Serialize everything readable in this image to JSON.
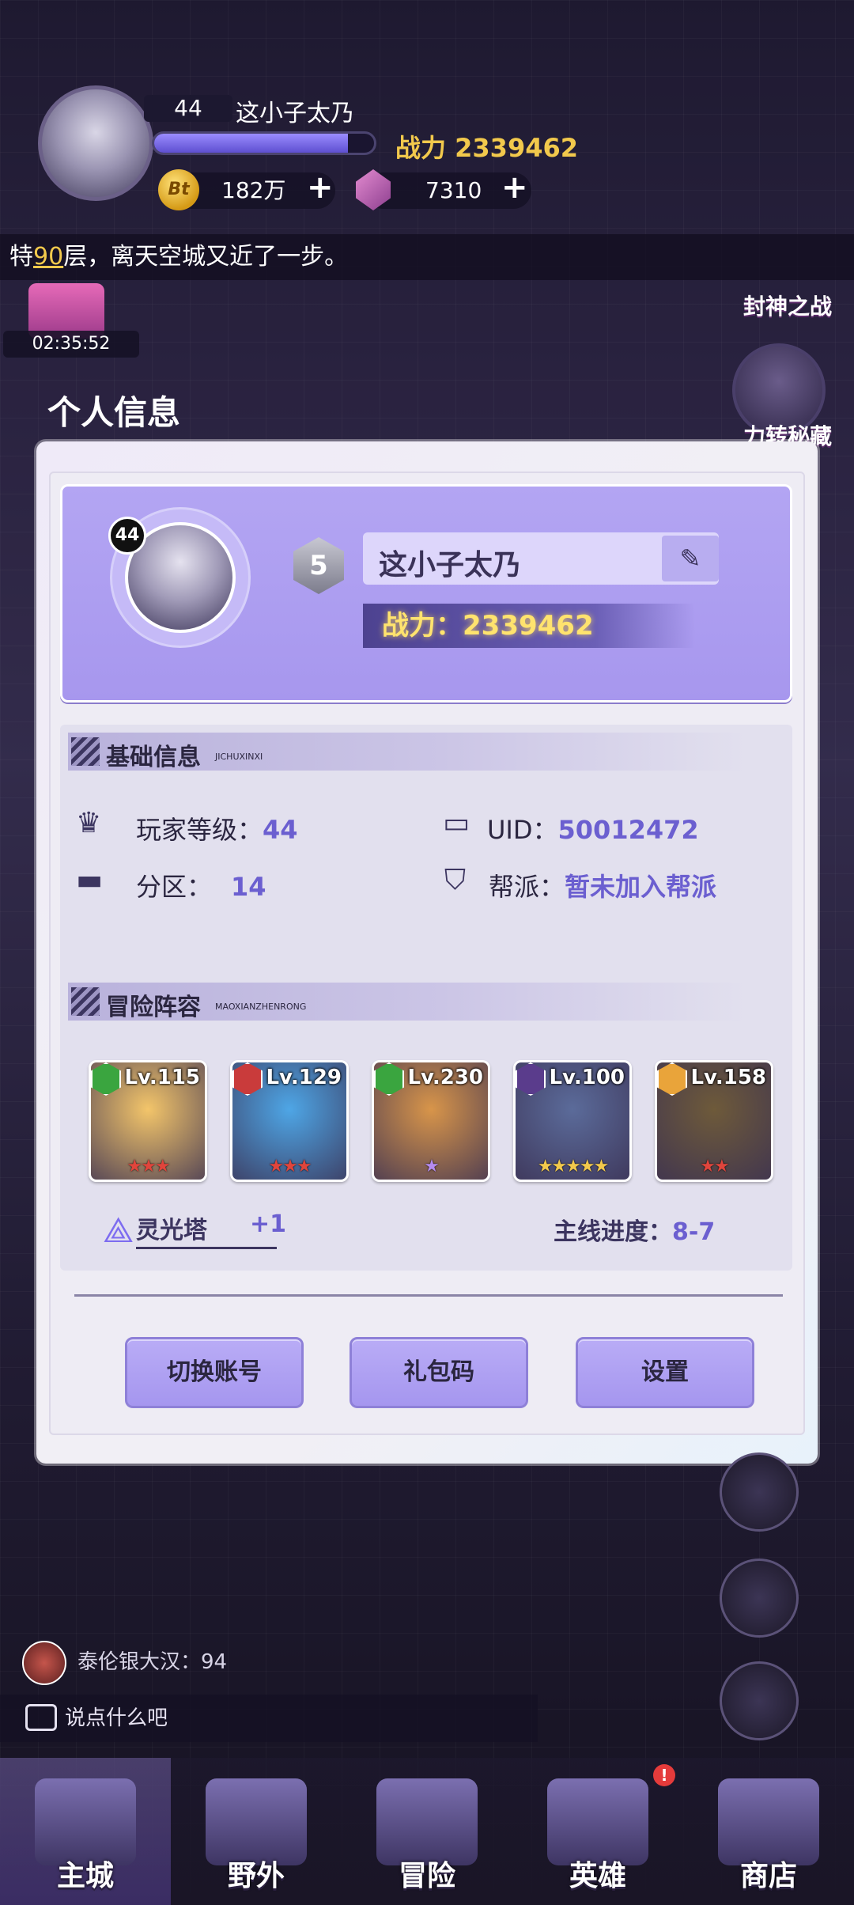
{
  "hud": {
    "level": "44",
    "name": "这小子太乃",
    "exp_fraction": 0.88,
    "power_label": "战力 2339462",
    "coin_icon_text": "Bt",
    "coins": "182万",
    "gems": "7310",
    "plus": "+"
  },
  "ticker": {
    "prefix": "层",
    "floor": "90",
    "text": "层，离天空城又近了一步。",
    "lead": "特"
  },
  "event": {
    "timer": "02:35:52"
  },
  "side_labels": {
    "fengshen": "封神之战",
    "lifu": "力转秘藏"
  },
  "page_title": "个人信息",
  "profile": {
    "avatar_level": "44",
    "vip_level": "5",
    "name": "这小子太乃",
    "power": "战力：2339462"
  },
  "basic_info": {
    "title": "基础信息",
    "subtitle": "JICHUXINXI",
    "rows": [
      {
        "label": "玩家等级：",
        "value": "44"
      },
      {
        "label": "UID：",
        "value": "50012472"
      },
      {
        "label": "分区：",
        "value": "14"
      },
      {
        "label": "帮派：",
        "value": "暂未加入帮派"
      }
    ]
  },
  "lineup": {
    "title": "冒险阵容",
    "subtitle": "MAOXIANZHENRONG",
    "heroes": [
      {
        "level": "Lv.115",
        "stars": "★★★",
        "faction_color": "#3aa53f",
        "star_color": "#e0453c",
        "art": "#f3c56a"
      },
      {
        "level": "Lv.129",
        "stars": "★★★",
        "faction_color": "#c93b3b",
        "star_color": "#e0453c",
        "art": "#4ea6e6"
      },
      {
        "level": "Lv.230",
        "stars": "★",
        "faction_color": "#3aa53f",
        "star_color": "#b58bf0",
        "art": "#d8954a"
      },
      {
        "level": "Lv.100",
        "stars": "★★★★★",
        "faction_color": "#5a3c8c",
        "star_color": "#f2c94c",
        "art": "#5b6b9a"
      },
      {
        "level": "Lv.158",
        "stars": "★★",
        "faction_color": "#e9a43a",
        "star_color": "#e0453c",
        "art": "#6e5a3a"
      }
    ],
    "tower_label": "灵光塔",
    "tower_value": "+1",
    "mainline_label": "主线进度：",
    "mainline_value": "8-7"
  },
  "buttons": {
    "switch_account": "切换账号",
    "gift_code": "礼包码",
    "settings": "设置"
  },
  "chat": {
    "last_message": "泰伦银大汉：94",
    "placeholder": "说点什么吧"
  },
  "nav": {
    "items": [
      "主城",
      "野外",
      "冒险",
      "英雄",
      "商店"
    ],
    "active_index": 0,
    "hero_badge": "!"
  },
  "colors": {
    "accent": "#6b5fd0",
    "card": "#a797ee",
    "power_gold": "#ffe36e"
  }
}
